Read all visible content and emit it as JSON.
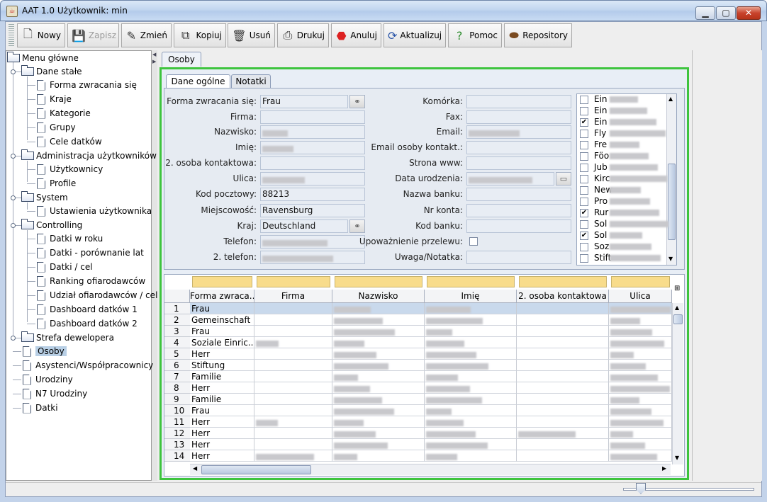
{
  "window": {
    "title": "AAT 1.0  Użytkownik: min",
    "minimize": "▁",
    "maximize": "▢",
    "close": "✕"
  },
  "toolbar": {
    "buttons": [
      {
        "label": "Nowy",
        "icon": "new-document-icon",
        "enabled": true
      },
      {
        "label": "Zapisz",
        "icon": "save-icon",
        "enabled": false
      },
      {
        "label": "Zmień",
        "icon": "edit-icon",
        "enabled": true
      },
      {
        "label": "Kopiuj",
        "icon": "copy-icon",
        "enabled": true
      },
      {
        "label": "Usuń",
        "icon": "trash-icon",
        "enabled": true
      },
      {
        "label": "Drukuj",
        "icon": "printer-icon",
        "enabled": true
      },
      {
        "label": "Anuluj",
        "icon": "stop-icon",
        "enabled": true
      },
      {
        "label": "Aktualizuj",
        "icon": "refresh-icon",
        "enabled": true
      },
      {
        "label": "Pomoc",
        "icon": "help-icon",
        "enabled": true
      },
      {
        "label": "Repository",
        "icon": "repository-icon",
        "enabled": true
      }
    ]
  },
  "tree": {
    "root": "Menu główne",
    "groups": [
      {
        "label": "Dane stałe",
        "items": [
          "Forma zwracania się",
          "Kraje",
          "Kategorie",
          "Grupy",
          "Cele datków"
        ]
      },
      {
        "label": "Administracja użytkowników",
        "items": [
          "Użytkownicy",
          "Profile"
        ]
      },
      {
        "label": "System",
        "items": [
          "Ustawienia użytkownika"
        ]
      },
      {
        "label": "Controlling",
        "items": [
          "Datki w roku",
          "Datki - porównanie lat",
          "Datki / cel",
          "Ranking ofiarodawców",
          "Udział ofiarodawców / cel",
          "Dashboard datków 1",
          "Dashboard datków 2"
        ]
      },
      {
        "label": "Strefa dewelopera",
        "items": []
      }
    ],
    "top_items": [
      "Osoby",
      "Asystenci/Współpracownicy",
      "Urodziny",
      "N7 Urodziny",
      "Datki"
    ],
    "selected": "Osoby"
  },
  "main": {
    "outer_tab": "Osoby",
    "inner_tabs": [
      "Dane ogólne",
      "Notatki"
    ],
    "form_left": [
      {
        "label": "Forma zwracania się:",
        "value": "Frau",
        "lookup": true
      },
      {
        "label": "Firma:",
        "value": ""
      },
      {
        "label": "Nazwisko:",
        "value": "",
        "blurred": true
      },
      {
        "label": "Imię:",
        "value": "",
        "blurred": true
      },
      {
        "label": "2. osoba kontaktowa:",
        "value": ""
      },
      {
        "label": "Ulica:",
        "value": "",
        "blurred": true
      },
      {
        "label": "Kod pocztowy:",
        "value": "88213"
      },
      {
        "label": "Miejscowość:",
        "value": "Ravensburg"
      },
      {
        "label": "Kraj:",
        "value": "Deutschland",
        "lookup": true
      },
      {
        "label": "Telefon:",
        "value": "",
        "blurred": true
      },
      {
        "label": "2. telefon:",
        "value": "",
        "blurred": true
      }
    ],
    "form_right": [
      {
        "label": "Komórka:",
        "value": ""
      },
      {
        "label": "Fax:",
        "value": ""
      },
      {
        "label": "Email:",
        "value": "",
        "blurred": true
      },
      {
        "label": "Email osoby kontakt.:",
        "value": ""
      },
      {
        "label": "Strona www:",
        "value": ""
      },
      {
        "label": "Data urodzenia:",
        "value": "",
        "blurred": true
      },
      {
        "label": "Nazwa banku:",
        "value": ""
      },
      {
        "label": "Nr konta:",
        "value": ""
      },
      {
        "label": "Kod banku:",
        "value": ""
      },
      {
        "label": "Upoważnienie przelewu:",
        "value": "",
        "checkbox": true
      },
      {
        "label": "Uwaga/Notatka:",
        "value": ""
      }
    ],
    "categories": [
      {
        "text": "Ein",
        "checked": false
      },
      {
        "text": "Ein",
        "checked": false
      },
      {
        "text": "Ein",
        "checked": true
      },
      {
        "text": "Fly",
        "checked": false
      },
      {
        "text": "Fre",
        "checked": false
      },
      {
        "text": "Föo",
        "checked": false
      },
      {
        "text": "Jub",
        "checked": false
      },
      {
        "text": "Kirc",
        "checked": false
      },
      {
        "text": "New",
        "checked": false
      },
      {
        "text": "Pro",
        "checked": false
      },
      {
        "text": "Rur",
        "checked": true
      },
      {
        "text": "Sol",
        "checked": false
      },
      {
        "text": "Sol",
        "checked": true
      },
      {
        "text": "Soz",
        "checked": false
      },
      {
        "text": "Stift",
        "checked": false
      }
    ],
    "table": {
      "columns": [
        "Forma zwraca...",
        "Firma",
        "Nazwisko",
        "Imię",
        "2. osoba kontaktowa",
        "Ulica"
      ],
      "rows": [
        {
          "n": "1",
          "forma": "Frau"
        },
        {
          "n": "2",
          "forma": "Gemeinschaft"
        },
        {
          "n": "3",
          "forma": "Frau"
        },
        {
          "n": "4",
          "forma": "Soziale Einric..."
        },
        {
          "n": "5",
          "forma": "Herr"
        },
        {
          "n": "6",
          "forma": "Stiftung"
        },
        {
          "n": "7",
          "forma": "Familie"
        },
        {
          "n": "8",
          "forma": "Herr"
        },
        {
          "n": "9",
          "forma": "Familie"
        },
        {
          "n": "10",
          "forma": "Frau"
        },
        {
          "n": "11",
          "forma": "Herr"
        },
        {
          "n": "12",
          "forma": "Herr"
        },
        {
          "n": "13",
          "forma": "Herr"
        },
        {
          "n": "14",
          "forma": "Herr"
        }
      ]
    }
  },
  "colors": {
    "accent_green": "#3ec43e",
    "filter_yellow": "#f8dc8b",
    "selection": "#b8cfe5"
  }
}
